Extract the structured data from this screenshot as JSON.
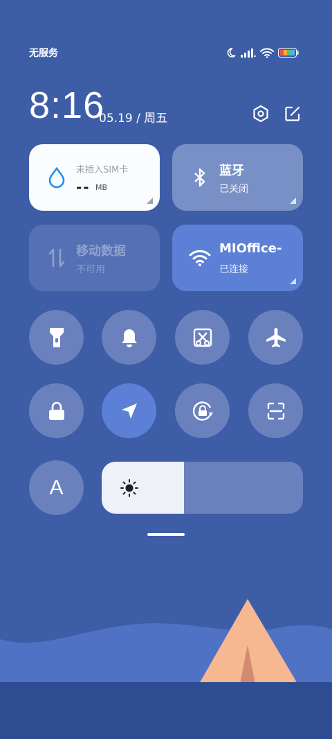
{
  "status": {
    "carrier": "无服务",
    "icons": [
      "moon-icon",
      "signal-icon",
      "wifi-icon",
      "battery-icon"
    ]
  },
  "header": {
    "time": "8:16",
    "date": "05.19 / 周五",
    "buttons": [
      "settings-icon",
      "edit-icon"
    ]
  },
  "tiles": {
    "data_usage": {
      "label": "未插入SIM卡",
      "value": "--",
      "unit": "MB"
    },
    "bluetooth": {
      "title": "蓝牙",
      "status": "已关闭"
    },
    "mobile_data": {
      "title": "移动数据",
      "status": "不可用"
    },
    "wifi": {
      "title": "MIOffice-",
      "status": "已连接"
    }
  },
  "toggles": [
    {
      "name": "flashlight",
      "active": false
    },
    {
      "name": "mute",
      "active": false
    },
    {
      "name": "screenshot",
      "active": false
    },
    {
      "name": "airplane-mode",
      "active": false
    },
    {
      "name": "lock-screen",
      "active": false
    },
    {
      "name": "location",
      "active": true
    },
    {
      "name": "rotation-lock",
      "active": false
    },
    {
      "name": "scanner",
      "active": false
    },
    {
      "name": "font-size",
      "active": false
    }
  ],
  "font_toggle_label": "A",
  "brightness": {
    "level": 0.41
  },
  "colors": {
    "background": "#3d5da6",
    "tile_active": "#5b80d6",
    "toggle": "#6a81be",
    "accent_blue": "#1e8ff0",
    "tent": "#f6b890"
  }
}
